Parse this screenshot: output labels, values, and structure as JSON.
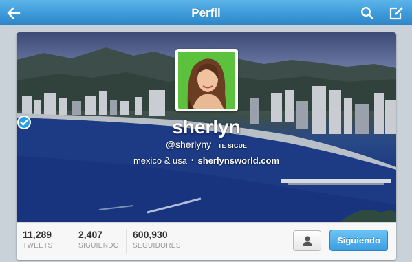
{
  "navbar": {
    "title": "Perfil",
    "back_icon": "back-arrow-icon",
    "search_icon": "search-icon",
    "compose_icon": "compose-icon",
    "color": "#3d9ad9"
  },
  "profile": {
    "name": "sherlyn",
    "verified": true,
    "handle": "@sherlyny",
    "follows_you": "TE SIGUE",
    "location": "mexico & usa",
    "separator": "•",
    "website": "sherlynsworld.com",
    "avatar_bg": "#5cc23d"
  },
  "stats": [
    {
      "value": "11,289",
      "label": "TWEETS"
    },
    {
      "value": "2,407",
      "label": "SIGUIENDO"
    },
    {
      "value": "600,930",
      "label": "SEGUIDORES"
    }
  ],
  "actions": {
    "profile_icon": "person-icon",
    "following_label": "Siguiendo",
    "following_color": "#3b9ee3"
  }
}
